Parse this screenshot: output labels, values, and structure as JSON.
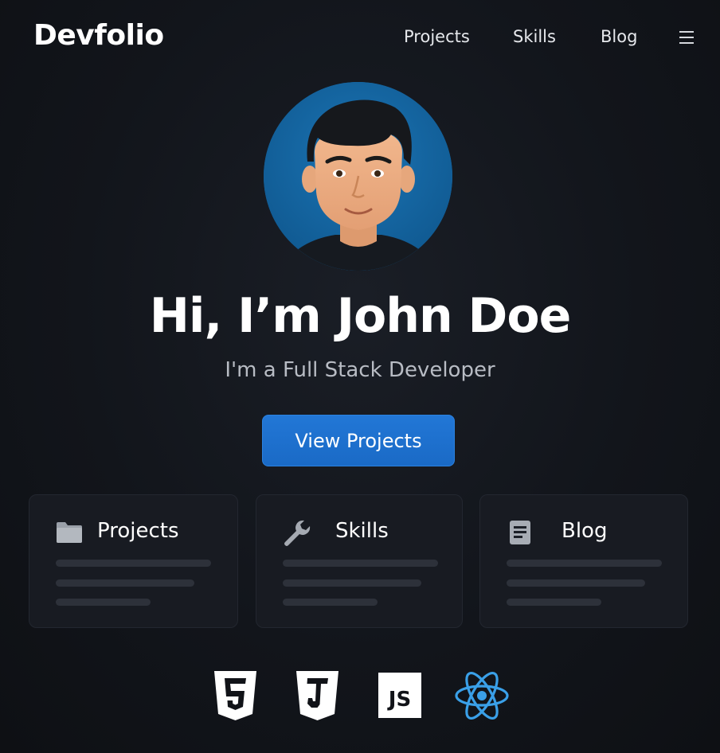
{
  "header": {
    "brand": "Devfolio",
    "nav": [
      {
        "label": "Projects"
      },
      {
        "label": "Skills"
      },
      {
        "label": "Blog"
      }
    ],
    "menu_icon": "hamburger-menu-icon"
  },
  "hero": {
    "avatar_icon": "developer-avatar-illustration",
    "title": "Hi, I’m John Doe",
    "subtitle": "I'm a Full Stack Developer",
    "cta_label": "View Projects"
  },
  "cards": [
    {
      "icon": "folder-icon",
      "title": "Projects"
    },
    {
      "icon": "wrench-icon",
      "title": "Skills"
    },
    {
      "icon": "document-icon",
      "title": "Blog"
    }
  ],
  "tech_icons": [
    "html5-icon",
    "css3-icon",
    "javascript-icon",
    "react-icon"
  ],
  "colors": {
    "background": "#12151b",
    "accent": "#1d6fcc",
    "card": "#181b22",
    "placeholder_line": "#2d313a",
    "avatar_bg": "#14609a",
    "react_blue": "#3aa0e8"
  }
}
